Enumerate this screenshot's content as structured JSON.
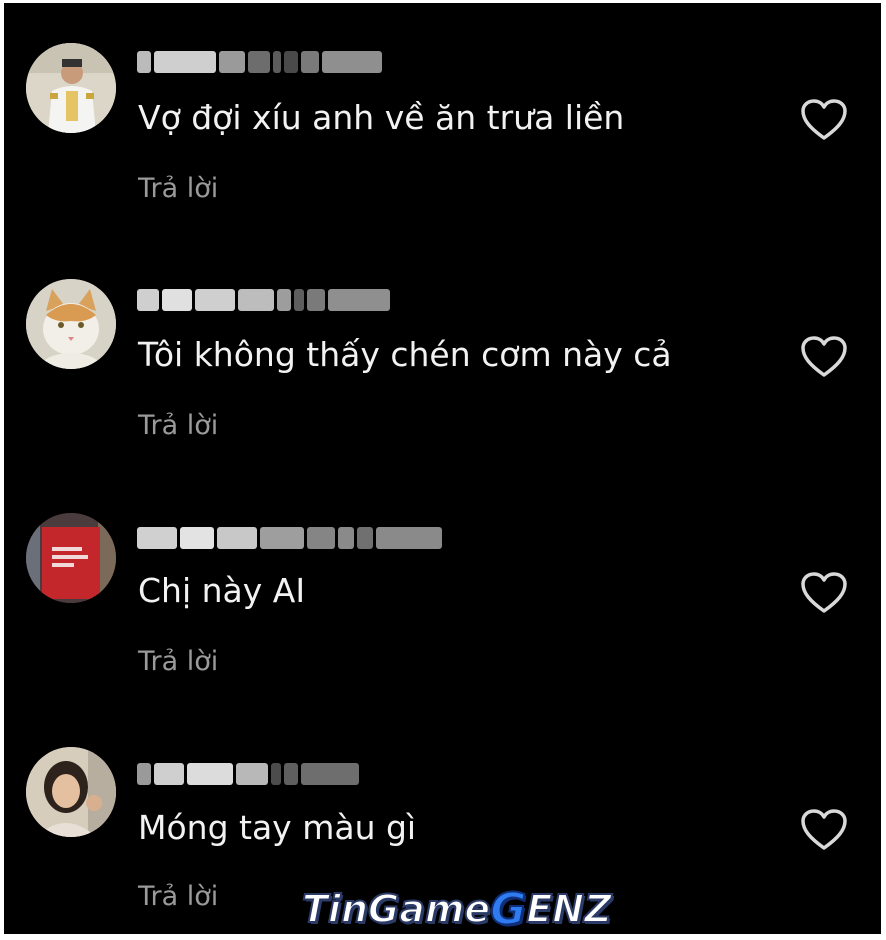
{
  "colors": {
    "background": "#000000",
    "text": "#f2f2f2",
    "reply": "#9a9a9a",
    "heart": "#d9d9d9"
  },
  "comments": [
    {
      "text": "Vợ đợi xíu anh về ăn trưa liền",
      "reply_label": "Trả lời",
      "avatar": "person-uniform-avatar"
    },
    {
      "text": "Tôi không thấy chén cơm này cả",
      "reply_label": "Trả lời",
      "avatar": "cat-avatar"
    },
    {
      "text": "Chị này AI",
      "reply_label": "Trả lời",
      "avatar": "red-book-avatar"
    },
    {
      "text": "Móng tay màu gì",
      "reply_label": "Trả lời",
      "avatar": "girl-avatar"
    }
  ],
  "watermark": {
    "part1": "TinGame",
    "part2": "G",
    "part3": "ENZ"
  }
}
